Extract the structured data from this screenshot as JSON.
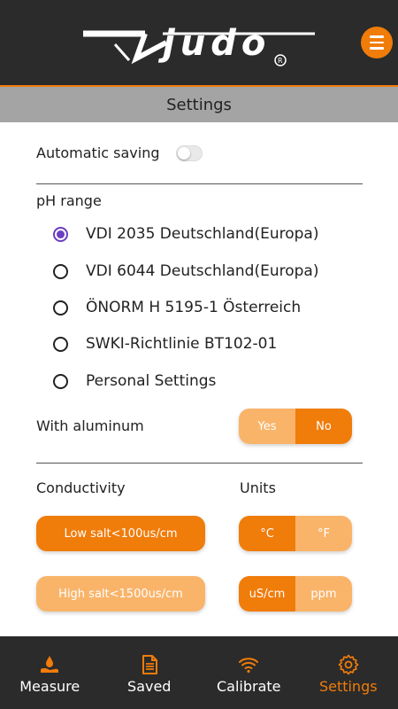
{
  "header": {
    "logo_text": "judo",
    "menu_icon": "hamburger-menu-icon"
  },
  "title": "Settings",
  "automatic_saving": {
    "label": "Automatic saving",
    "enabled": false
  },
  "ph_range": {
    "label": "pH range",
    "options": [
      "VDI 2035 Deutschland(Europa)",
      "VDI 6044 Deutschland(Europa)",
      "ÖNORM H 5195-1 Österreich",
      "SWKI-Richtlinie BT102-01",
      "Personal Settings"
    ],
    "selected": "VDI 2035 Deutschland(Europa)"
  },
  "with_aluminum": {
    "label": "With aluminum",
    "yes": "Yes",
    "no": "No",
    "selected": "No"
  },
  "conductivity": {
    "label": "Conductivity",
    "low": "Low salt<100us/cm",
    "high": "High salt<1500us/cm",
    "selected": "Low salt<100us/cm"
  },
  "units": {
    "label": "Units",
    "temp_c": "°C",
    "temp_f": "°F",
    "temp_selected": "°C",
    "cond_us": "uS/cm",
    "cond_ppm": "ppm",
    "cond_selected": "uS/cm"
  },
  "nav": {
    "items": [
      {
        "label": "Measure",
        "icon": "water-drop-hand-icon"
      },
      {
        "label": "Saved",
        "icon": "document-icon"
      },
      {
        "label": "Calibrate",
        "icon": "wifi-signal-icon"
      },
      {
        "label": "Settings",
        "icon": "gear-icon"
      }
    ],
    "active": "Settings"
  },
  "colors": {
    "accent": "#f07c0a",
    "accent_light": "#f9b46a",
    "dark_bar": "#2b2b2b",
    "title_bar": "#a4a4a4",
    "radio_selected": "#6a3fc2"
  }
}
